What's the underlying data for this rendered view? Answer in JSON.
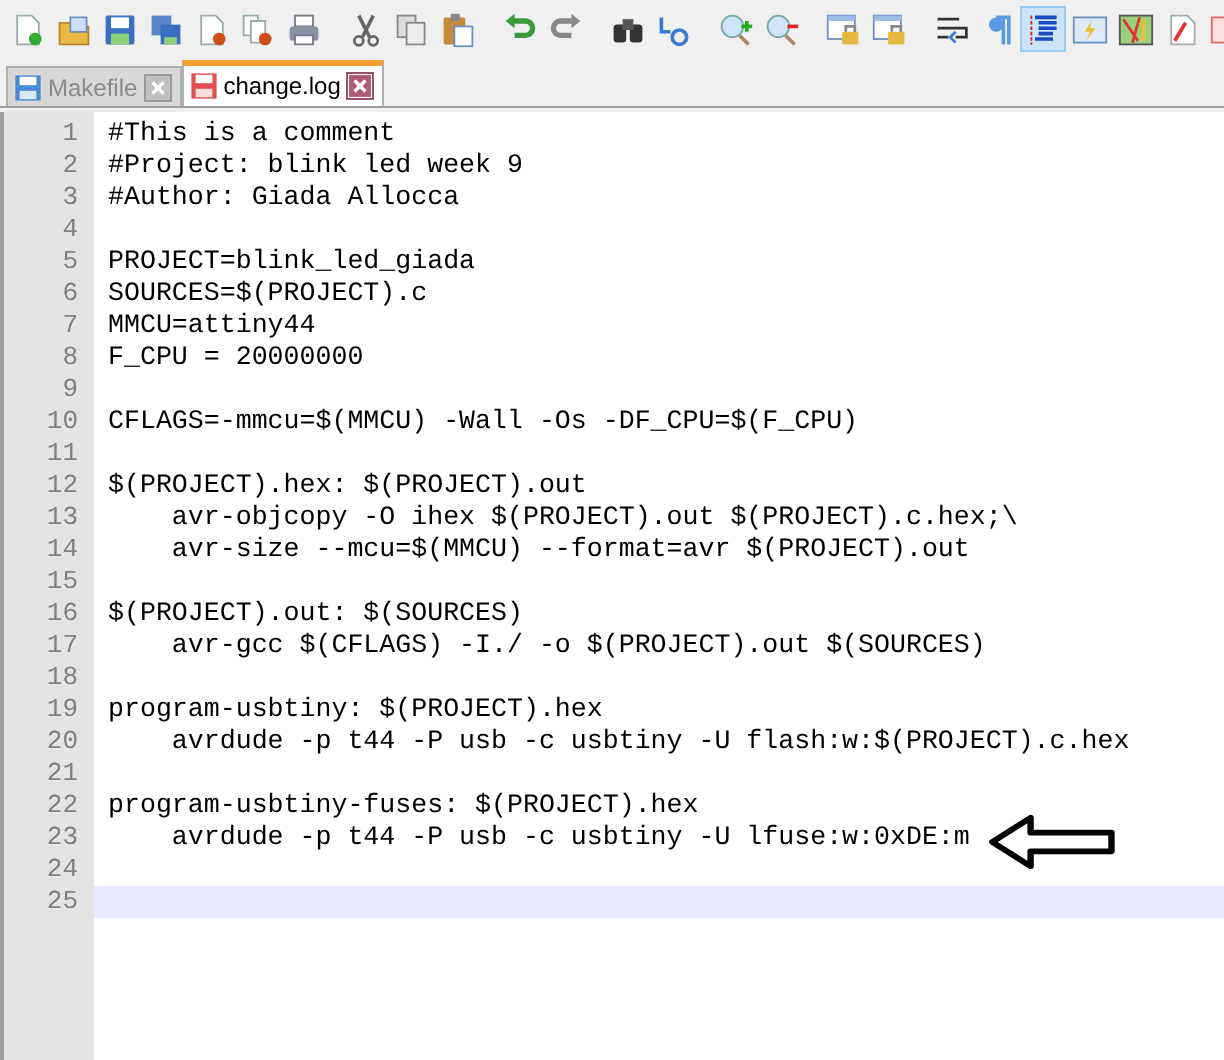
{
  "toolbar": [
    [
      {
        "kind": "new",
        "selected": false
      },
      {
        "kind": "open",
        "selected": false
      },
      {
        "kind": "save",
        "selected": false
      },
      {
        "kind": "save-all",
        "selected": false
      },
      {
        "kind": "close",
        "selected": false
      },
      {
        "kind": "close-all",
        "selected": false
      },
      {
        "kind": "print",
        "selected": false
      }
    ],
    [
      {
        "kind": "cut",
        "selected": false
      },
      {
        "kind": "copy",
        "selected": false
      },
      {
        "kind": "paste",
        "selected": false
      }
    ],
    [
      {
        "kind": "undo",
        "selected": false
      },
      {
        "kind": "redo",
        "selected": false
      }
    ],
    [
      {
        "kind": "find",
        "selected": false
      },
      {
        "kind": "replace",
        "selected": false
      }
    ],
    [
      {
        "kind": "zoom-in",
        "selected": false
      },
      {
        "kind": "zoom-out",
        "selected": false
      }
    ],
    [
      {
        "kind": "sync-v",
        "selected": false
      },
      {
        "kind": "sync-h",
        "selected": false
      }
    ],
    [
      {
        "kind": "wrap",
        "selected": false
      },
      {
        "kind": "pilcrow",
        "selected": false
      },
      {
        "kind": "indent-guide",
        "selected": true
      },
      {
        "kind": "udl",
        "selected": false
      },
      {
        "kind": "doc-map",
        "selected": false
      },
      {
        "kind": "function-list",
        "selected": false
      },
      {
        "kind": "doc-partial",
        "selected": false
      }
    ]
  ],
  "tabs": [
    {
      "label": "Makefile",
      "selected": false
    },
    {
      "label": "change.log",
      "selected": true
    }
  ],
  "lines": [
    {
      "number": "1",
      "text": "#This is a comment",
      "current": false
    },
    {
      "number": "2",
      "text": "#Project: blink led week 9",
      "current": false
    },
    {
      "number": "3",
      "text": "#Author: Giada Allocca",
      "current": false
    },
    {
      "number": "4",
      "current": false
    },
    {
      "number": "5",
      "text": "PROJECT=blink_led_giada",
      "current": false
    },
    {
      "number": "6",
      "text": "SOURCES=$(PROJECT).c",
      "current": false
    },
    {
      "number": "7",
      "text": "MMCU=attiny44",
      "current": false
    },
    {
      "number": "8",
      "text": "F_CPU = 20000000",
      "current": false
    },
    {
      "number": "9",
      "current": false
    },
    {
      "number": "10",
      "text": "CFLAGS=-mmcu=$(MMCU) -Wall -Os -DF_CPU=$(F_CPU)",
      "current": false
    },
    {
      "number": "11",
      "current": false
    },
    {
      "number": "12",
      "text": "$(PROJECT).hex: $(PROJECT).out",
      "current": false
    },
    {
      "number": "13",
      "text": "    avr-objcopy -O ihex $(PROJECT).out $(PROJECT).c.hex;\\",
      "current": false
    },
    {
      "number": "14",
      "text": "    avr-size --mcu=$(MMCU) --format=avr $(PROJECT).out",
      "current": false
    },
    {
      "number": "15",
      "current": false
    },
    {
      "number": "16",
      "text": "$(PROJECT).out: $(SOURCES)",
      "current": false
    },
    {
      "number": "17",
      "text": "    avr-gcc $(CFLAGS) -I./ -o $(PROJECT).out $(SOURCES)",
      "current": false
    },
    {
      "number": "18",
      "current": false
    },
    {
      "number": "19",
      "text": "program-usbtiny: $(PROJECT).hex",
      "current": false
    },
    {
      "number": "20",
      "text": "    avrdude -p t44 -P usb -c usbtiny -U flash:w:$(PROJECT).c.hex",
      "current": false
    },
    {
      "number": "21",
      "current": false
    },
    {
      "number": "22",
      "text": "program-usbtiny-fuses: $(PROJECT).hex",
      "current": false
    },
    {
      "number": "23",
      "text": "    avrdude -p t44 -P usb -c usbtiny -U lfuse:w:0xDE:m",
      "current": false
    },
    {
      "number": "24",
      "current": false
    },
    {
      "number": "25",
      "current": true
    }
  ]
}
